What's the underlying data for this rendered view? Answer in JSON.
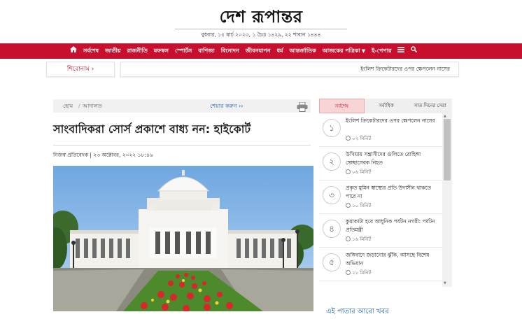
{
  "header": {
    "logo": "দেশ রূপান্তর",
    "date_line": "বুধবার, ১৫ মার্চ ২০২৩, ১ চৈত্র ১৪২৯, ২২ শাবান ১৪৪৪"
  },
  "nav": {
    "items": [
      "সর্বশেষ",
      "জাতীয়",
      "রাজনীতি",
      "মফস্বল",
      "স্পোর্টস",
      "বাণিজ্য",
      "বিনোদন",
      "জীবনযাপন",
      "ধর্ম",
      "আন্তর্জাতিক",
      "আজকের পত্রিকা",
      "ই-পেপার"
    ]
  },
  "ticker": {
    "label": "শিরোনাম ›",
    "text": "ইংলিশ ক্রিকেটারদের ওপর ক্ষেপলেন নাসের"
  },
  "breadcrumb": {
    "home": "হোম",
    "separator": "/",
    "category": "আদালত",
    "share": "শেয়ার করুন ››"
  },
  "article": {
    "headline": "সাংবাদিকরা সোর্স প্রকাশে বাধ্য নন: হাইকোর্ট",
    "byline": "নিজস্ব প্রতিবেদক | ২৩ অক্টোবর, ২০২২ ১৮:৪৬"
  },
  "sidebar": {
    "tabs": [
      "সর্বশেষ",
      "সর্বাধিক",
      "সাত দিনের সেরা"
    ],
    "items": [
      {
        "num": "১",
        "title": "ইংলিশ ক্রিকেটারদের ওপর ক্ষেপলেন নাসের",
        "time": "০২ মিনিট"
      },
      {
        "num": "২",
        "title": "উখিয়ায় সন্ত্রাসীদের গুলিতে রোহিঙ্গা স্বেচ্ছাসেবক নিহত",
        "time": "০৬ মিনিট"
      },
      {
        "num": "৩",
        "title": "প্রকৃত মুমিন স্বাস্থ্যের প্রতি উদাসীন থাকতে পারে না",
        "time": "১০ মিনিট"
      },
      {
        "num": "৪",
        "title": "কুয়াকাটা হবে আধুনিক পর্যটন নগরী: পর্যটন প্রতিমন্ত্রী",
        "time": "১৬ মিনিট"
      },
      {
        "num": "৫",
        "title": "জঙ্গিবাদে জড়ানোর ঝুঁকি, আসছে বিশেষ অভিযান",
        "time": "২১ মিনিট"
      }
    ],
    "more": "এই পাতার আরো খবর"
  },
  "colors": {
    "brand": "#c8102e",
    "link": "#1a5fa8"
  }
}
